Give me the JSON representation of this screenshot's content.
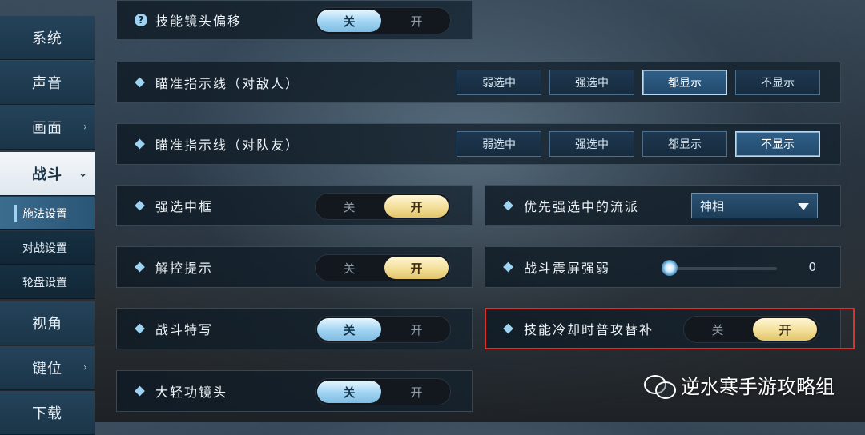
{
  "sidebar": {
    "items": [
      {
        "label": "系统",
        "arrow": ""
      },
      {
        "label": "声音",
        "arrow": ""
      },
      {
        "label": "画面",
        "arrow": "›"
      },
      {
        "label": "战斗",
        "arrow": "⌄"
      },
      {
        "label": "视角",
        "arrow": ""
      },
      {
        "label": "键位",
        "arrow": "›"
      },
      {
        "label": "下载",
        "arrow": ""
      }
    ],
    "subitems": [
      {
        "label": "施法设置"
      },
      {
        "label": "对战设置"
      },
      {
        "label": "轮盘设置"
      }
    ]
  },
  "settings": {
    "skill_camera_offset": {
      "label": "技能镜头偏移",
      "off": "关",
      "on": "开",
      "value": "关"
    },
    "aim_enemy": {
      "label": "瞄准指示线（对敌人）",
      "options": [
        "弱选中",
        "强选中",
        "都显示",
        "不显示"
      ],
      "selected": "都显示"
    },
    "aim_team": {
      "label": "瞄准指示线（对队友）",
      "options": [
        "弱选中",
        "强选中",
        "都显示",
        "不显示"
      ],
      "selected": "不显示"
    },
    "strong_select_frame": {
      "label": "强选中框",
      "off": "关",
      "on": "开",
      "value": "开"
    },
    "priority_school": {
      "label": "优先强选中的流派",
      "value": "神相"
    },
    "control_hint": {
      "label": "解控提示",
      "off": "关",
      "on": "开",
      "value": "开"
    },
    "screen_shake": {
      "label": "战斗震屏强弱",
      "value": "0"
    },
    "combat_closeup": {
      "label": "战斗特写",
      "off": "关",
      "on": "开",
      "value": "关"
    },
    "cooldown_attack": {
      "label": "技能冷却时普攻替补",
      "off": "关",
      "on": "开",
      "value": "开"
    },
    "qinggong_camera": {
      "label": "大轻功镜头",
      "off": "关",
      "on": "开",
      "value": "关"
    }
  },
  "watermark": {
    "text": "逆水寒手游攻略组"
  },
  "colors": {
    "highlight": "#e0302a",
    "toggle_on_blue": "#9fd3f2",
    "toggle_on_gold": "#f3df98",
    "accent": "#9ed3f2"
  }
}
